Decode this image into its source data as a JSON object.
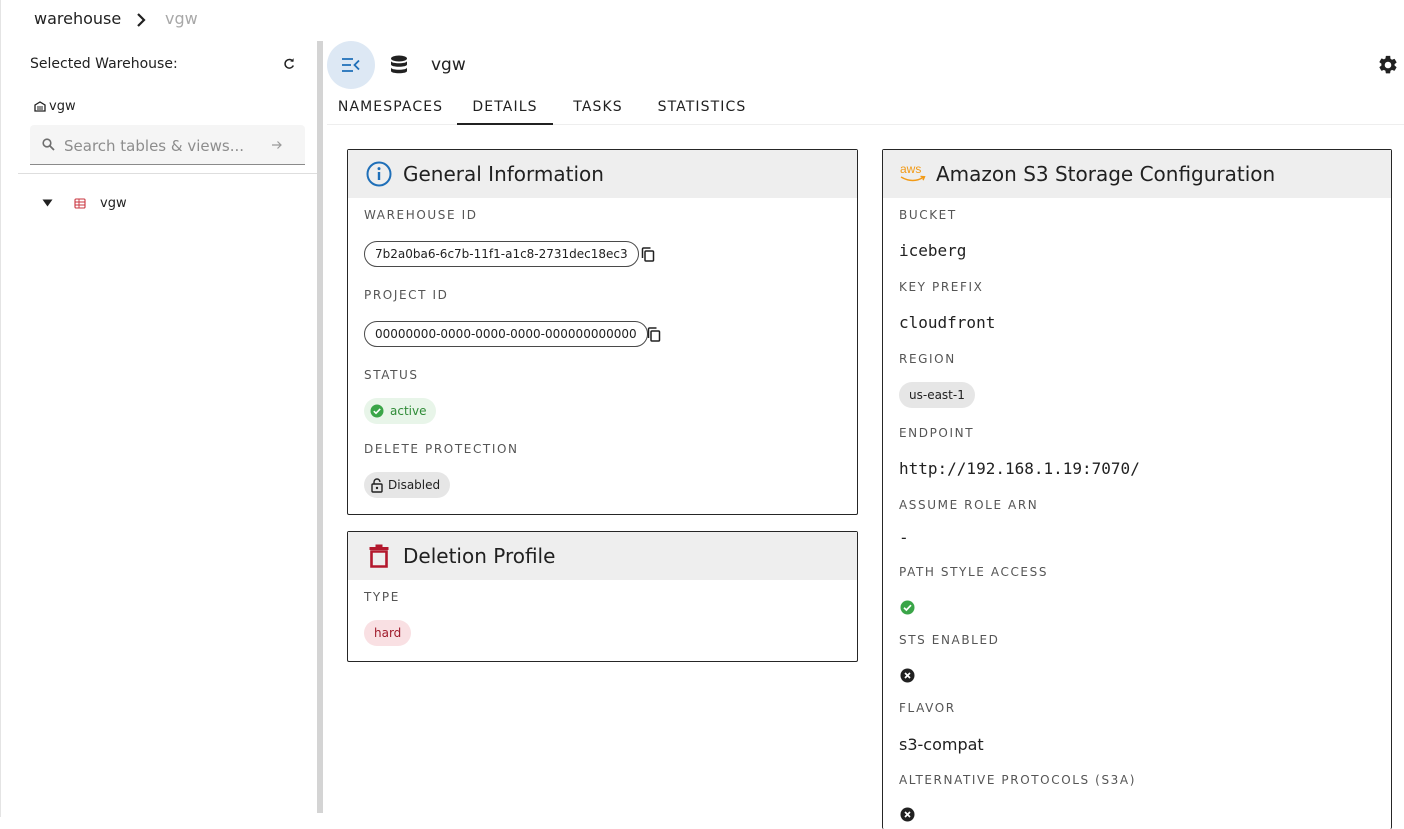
{
  "breadcrumb": {
    "root": "warehouse",
    "current": "vgw"
  },
  "sidebar": {
    "selected_label": "Selected Warehouse:",
    "warehouse_name": "vgw",
    "search_placeholder": "Search tables & views...",
    "tree": [
      {
        "label": "vgw",
        "expanded": true
      }
    ]
  },
  "header": {
    "title": "vgw"
  },
  "tabs": [
    {
      "label": "NAMESPACES",
      "active": false
    },
    {
      "label": "DETAILS",
      "active": true
    },
    {
      "label": "TASKS",
      "active": false
    },
    {
      "label": "STATISTICS",
      "active": false
    }
  ],
  "general": {
    "title": "General Information",
    "warehouse_id_label": "WAREHOUSE ID",
    "warehouse_id": "7b2a0ba6-6c7b-11f1-a1c8-2731dec18ec3",
    "project_id_label": "PROJECT ID",
    "project_id": "00000000-0000-0000-0000-000000000000",
    "status_label": "STATUS",
    "status": "active",
    "delete_protection_label": "DELETE PROTECTION",
    "delete_protection": "Disabled"
  },
  "deletion": {
    "title": "Deletion Profile",
    "type_label": "TYPE",
    "type": "hard"
  },
  "storage": {
    "title": "Amazon S3 Storage Configuration",
    "aws_logo": "aws",
    "bucket_label": "BUCKET",
    "bucket": "iceberg",
    "key_prefix_label": "KEY PREFIX",
    "key_prefix": "cloudfront",
    "region_label": "REGION",
    "region": "us-east-1",
    "endpoint_label": "ENDPOINT",
    "endpoint": "http://192.168.1.19:7070/",
    "assume_role_label": "ASSUME ROLE ARN",
    "assume_role": "-",
    "path_style_label": "PATH STYLE ACCESS",
    "path_style_enabled": true,
    "sts_label": "STS ENABLED",
    "sts_enabled": false,
    "flavor_label": "FLAVOR",
    "flavor": "s3-compat",
    "alt_protocols_label": "ALTERNATIVE PROTOCOLS (S3A)"
  },
  "colors": {
    "accent": "#1f6fb8",
    "success": "#3aa548",
    "danger": "#b3182d",
    "aws_orange": "#f29a16"
  },
  "icons": [
    "chevron-right-icon",
    "refresh-icon",
    "warehouse-icon",
    "search-icon",
    "arrow-right-icon",
    "caret-down-icon",
    "table-icon",
    "collapse-sidebar-icon",
    "database-icon",
    "gear-icon",
    "info-icon",
    "copy-icon",
    "check-circle-icon",
    "lock-open-icon",
    "trash-icon",
    "aws-icon",
    "close-circle-icon"
  ]
}
